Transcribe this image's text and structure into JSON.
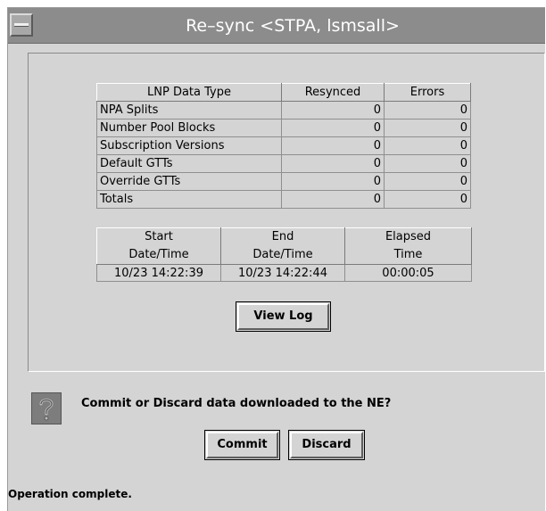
{
  "window": {
    "title": "Re–sync <STPA, lsmsall>"
  },
  "lnp_table": {
    "headers": [
      "LNP Data Type",
      "Resynced",
      "Errors"
    ],
    "rows": [
      {
        "type": "NPA Splits",
        "resynced": "0",
        "errors": "0"
      },
      {
        "type": "Number Pool Blocks",
        "resynced": "0",
        "errors": "0"
      },
      {
        "type": "Subscription Versions",
        "resynced": "0",
        "errors": "0"
      },
      {
        "type": "Default GTTs",
        "resynced": "0",
        "errors": "0"
      },
      {
        "type": "Override GTTs",
        "resynced": "0",
        "errors": "0"
      },
      {
        "type": "Totals",
        "resynced": "0",
        "errors": "0"
      }
    ]
  },
  "time_table": {
    "headers": [
      {
        "line1": "Start",
        "line2": "Date/Time"
      },
      {
        "line1": "End",
        "line2": "Date/Time"
      },
      {
        "line1": "Elapsed",
        "line2": "Time"
      }
    ],
    "values": [
      "10/23 14:22:39",
      "10/23 14:22:44",
      "00:00:05"
    ]
  },
  "buttons": {
    "view_log": "View Log",
    "commit": "Commit",
    "discard": "Discard"
  },
  "prompt": {
    "icon": "question-icon",
    "text": "Commit or Discard data downloaded to the NE?"
  },
  "status": {
    "text": "Operation complete."
  },
  "colors": {
    "window_bg": "#d4d4d4",
    "titlebar_bg": "#8c8c8c",
    "title_text": "#ffffff",
    "icon_bg": "#7d7d7d"
  }
}
